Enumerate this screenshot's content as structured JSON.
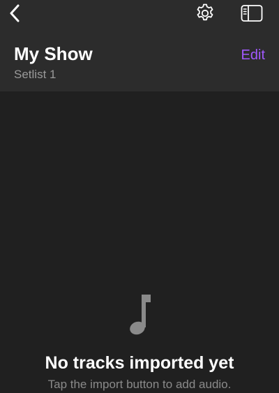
{
  "nav": {
    "back_icon": "chevron-left-icon",
    "settings_icon": "gear-icon",
    "sidebar_icon": "sidebar-icon"
  },
  "header": {
    "title": "My Show",
    "subtitle": "Setlist 1",
    "edit_label": "Edit"
  },
  "empty_state": {
    "icon": "music-note-icon",
    "title": "No tracks imported yet",
    "subtitle": "Tap the import button to add audio."
  },
  "colors": {
    "background": "#202020",
    "header_background": "#2c2c2c",
    "accent": "#a259ff",
    "secondary_text": "#9a9a9a"
  }
}
